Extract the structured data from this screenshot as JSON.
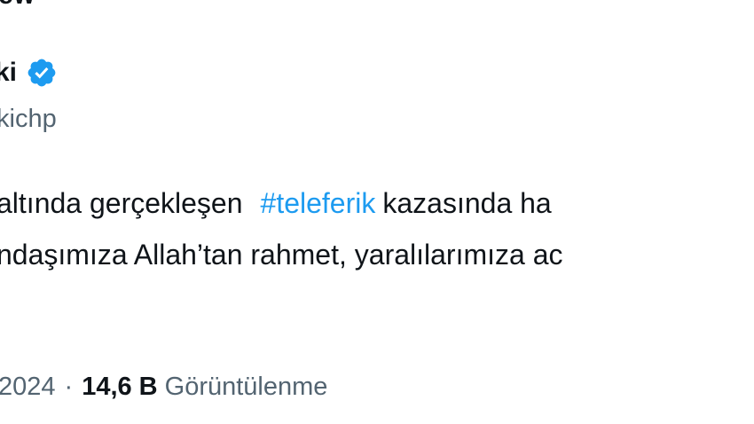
{
  "tweet": {
    "top_fragment": "ew",
    "author": {
      "display_name": "ki",
      "handle": "kichp",
      "verified_icon": "verified-badge-icon"
    },
    "body": {
      "line1_before": "altında gerçekleşen",
      "hashtag": "#teleferik",
      "line1_after": "kazasında ha",
      "line2": "ndaşımıza Allah’tan rahmet, yaralılarımıza ac"
    },
    "meta": {
      "date": "2024",
      "separator": "·",
      "views_count": "14,6 B",
      "views_label": "Görüntülenme"
    }
  },
  "colors": {
    "text": "#0f1419",
    "secondary_text": "#536471",
    "link": "#1d9bf0",
    "verified": "#1d9bf0"
  }
}
